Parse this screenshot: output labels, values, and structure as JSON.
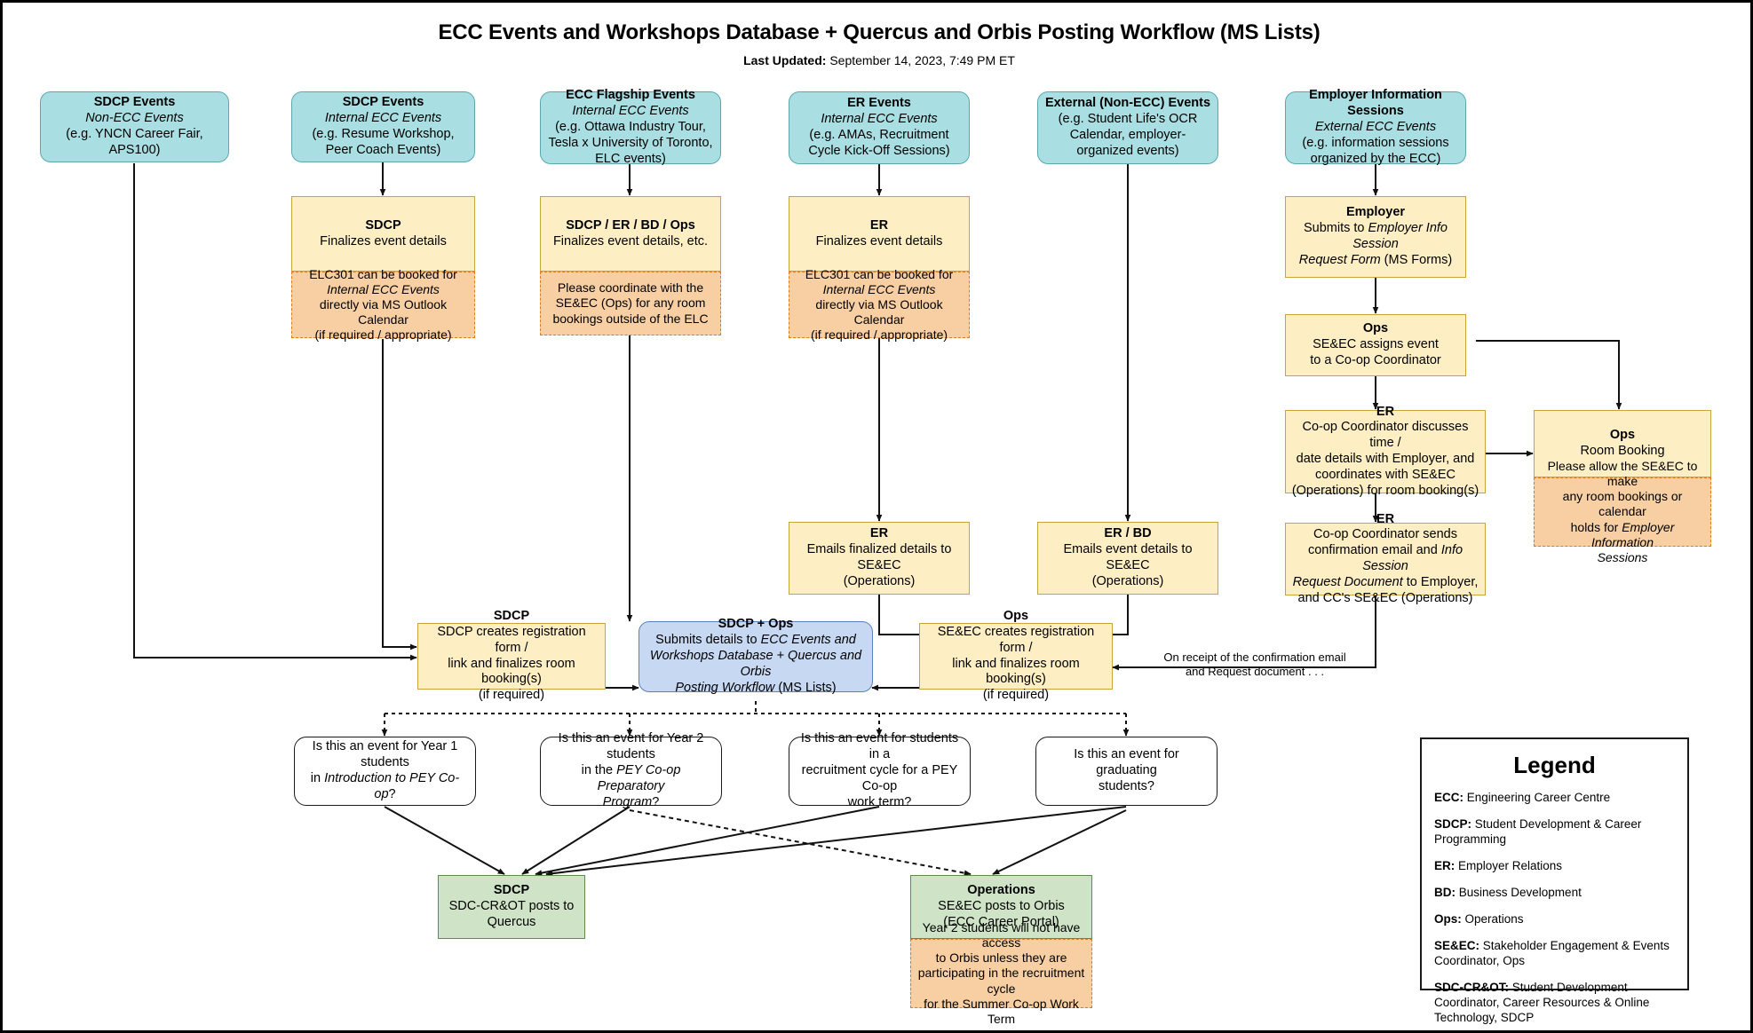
{
  "title": "ECC Events and Workshops Database + Quercus and Orbis Posting Workflow (MS Lists)",
  "subtitle": {
    "label": "Last Updated:",
    "value": " September 14, 2023, 7:49 PM ET"
  },
  "colors": {
    "teal": "#a9dfe3",
    "yellow": "#fdeec4",
    "orange": "#f7cfa2",
    "blue": "#c7d9f2",
    "green": "#cfe4c6",
    "white": "#ffffff"
  },
  "sources": [
    {
      "id": "sdcp-non-ecc",
      "head": "SDCP Events",
      "sub": "Non-ECC Events",
      "detail": "(e.g. YNCN Career Fair, APS100)"
    },
    {
      "id": "sdcp-internal",
      "head": "SDCP Events",
      "sub": "Internal ECC Events",
      "detail": "(e.g. Resume Workshop, Peer Coach Events)"
    },
    {
      "id": "ecc-flagship",
      "head": "ECC Flagship Events",
      "sub": "Internal ECC Events",
      "detail": "(e.g. Ottawa Industry Tour, Tesla x University of Toronto, ELC events)"
    },
    {
      "id": "er-events",
      "head": "ER Events",
      "sub": "Internal ECC Events",
      "detail": "(e.g. AMAs, Recruitment Cycle Kick-Off Sessions)"
    },
    {
      "id": "external-non-ecc",
      "head": "External (Non-ECC) Events",
      "sub": "",
      "detail": "(e.g. Student Life's OCR Calendar, employer-organized events)"
    },
    {
      "id": "employer-info-sessions",
      "head": "Employer Information Sessions",
      "sub": "External ECC Events",
      "detail": "(e.g. information sessions organized by the ECC)"
    }
  ],
  "process": {
    "sdcp_finalizes": {
      "head": "SDCP",
      "body": "Finalizes event details"
    },
    "sdcp_finalizes_note": "ELC301 can be booked for Internal ECC Events directly via MS Outlook Calendar (if required / appropriate)",
    "sdcp_finalizes_note_parts": {
      "l1": "ELC301 can be booked for",
      "l2_italic": "Internal ECC Events",
      "l3": "directly via MS Outlook Calendar",
      "l4": "(if required / appropriate)"
    },
    "flagship_finalizes": {
      "head": "SDCP / ER / BD / Ops",
      "body": "Finalizes event details, etc."
    },
    "flagship_note": "Please coordinate with the SE&EC (Ops) for any room bookings outside of the ELC",
    "er_finalizes": {
      "head": "ER",
      "body": "Finalizes event details"
    },
    "er_finalizes_note_parts": {
      "l1": "ELC301 can be booked for",
      "l2_italic": "Internal ECC Events",
      "l3": "directly via MS Outlook Calendar",
      "l4": "(if required / appropriate)"
    },
    "employer_submits": {
      "head": "Employer",
      "l1": "Submits to ",
      "l1_italic": "Employer Info Session",
      "l2_italic": "Request Form",
      "l2": " (MS Forms)"
    },
    "ops_assigns": {
      "head": "Ops",
      "l1": "SE&EC assigns event",
      "l2": "to a Co-op Coordinator"
    },
    "ops_room_booking": {
      "head": "Ops",
      "body": "Room Booking"
    },
    "ops_room_booking_note_parts": {
      "l1": "Please allow the SE&EC to make",
      "l2": "any room bookings or calendar",
      "l3": "holds for ",
      "l3_italic": "Employer Information",
      "l4_italic": "Sessions"
    },
    "er_coordinator_discusses": {
      "head": "ER",
      "l1": "Co-op Coordinator discusses time /",
      "l2": "date details with Employer, and",
      "l3": "coordinates with SE&EC",
      "l4": "(Operations) for room booking(s)"
    },
    "er_coordinator_sends": {
      "head": "ER",
      "l1": "Co-op Coordinator sends",
      "l2a": "confirmation email and ",
      "l2i": "Info Session",
      "l3i": "Request Document",
      "l3a": " to Employer,",
      "l4": "and CC's SE&EC (Operations)"
    },
    "er_emails_finalized": {
      "head": "ER",
      "l1": "Emails finalized details to SE&EC",
      "l2": "(Operations)"
    },
    "erbd_emails_event": {
      "head": "ER / BD",
      "l1": "Emails event details to SE&EC",
      "l2": "(Operations)"
    },
    "sdcp_creates_reg": {
      "head": "SDCP",
      "l1": "SDCP creates registration form /",
      "l2": "link and finalizes room booking(s)",
      "l3": "(if required)"
    },
    "ops_creates_reg": {
      "head": "Ops",
      "l1": "SE&EC creates registration form /",
      "l2": "link and finalizes room booking(s)",
      "l3": "(if required)"
    },
    "central": {
      "head": "SDCP + Ops",
      "l1a": "Submits details to ",
      "l1i": "ECC Events and",
      "l2i": "Workshops Database + Quercus and Orbis",
      "l3i": "Posting Workflow",
      "l3a": " (MS Lists)"
    }
  },
  "edge_labels": {
    "on_receipt": {
      "l1": "On receipt of the confirmation email",
      "l2a": "and ",
      "l2i": "Request",
      "l2b": " document . . ."
    }
  },
  "decisions": [
    {
      "id": "year1",
      "l1": "Is this an event for Year 1 students",
      "l2a": "in ",
      "l2i": "Introduction to PEY Co-op",
      "l2b": "?"
    },
    {
      "id": "year2",
      "l1": "Is this an event for Year 2 students",
      "l2a": "in the ",
      "l2i": "PEY Co-op Preparatory",
      "l3i": "Program",
      "l3b": "?"
    },
    {
      "id": "recruitment",
      "l1": "Is this an event for students in a",
      "l2": "recruitment cycle for a PEY Co-op",
      "l3": "work term?"
    },
    {
      "id": "graduating",
      "l1": "Is this an event for graduating",
      "l2": "students?"
    }
  ],
  "outcomes": {
    "quercus": {
      "head": "SDCP",
      "body": "SDC-CR&OT posts to Quercus"
    },
    "orbis": {
      "head": "Operations",
      "l1": "SE&EC posts to Orbis",
      "l2": "(ECC Career Portal)"
    },
    "orbis_note": {
      "l1": "Year 2 students will not have access",
      "l2": "to Orbis unless they are",
      "l3": "participating in the recruitment cycle",
      "l4": "for the Summer Co-op Work Term"
    }
  },
  "legend": {
    "title": "Legend",
    "entries": [
      {
        "term": "ECC:",
        "def": " Engineering Career Centre"
      },
      {
        "term": "SDCP:",
        "def": " Student Development & Career Programming"
      },
      {
        "term": "ER:",
        "def": " Employer Relations"
      },
      {
        "term": "BD:",
        "def": " Business Development"
      },
      {
        "term": "Ops:",
        "def": " Operations"
      },
      {
        "term": "SE&EC:",
        "def": " Stakeholder Engagement & Events Coordinator, Ops"
      },
      {
        "term": "SDC-CR&OT:",
        "def": " Student Development Coordinator, Career Resources & Online Technology, SDCP"
      }
    ]
  }
}
